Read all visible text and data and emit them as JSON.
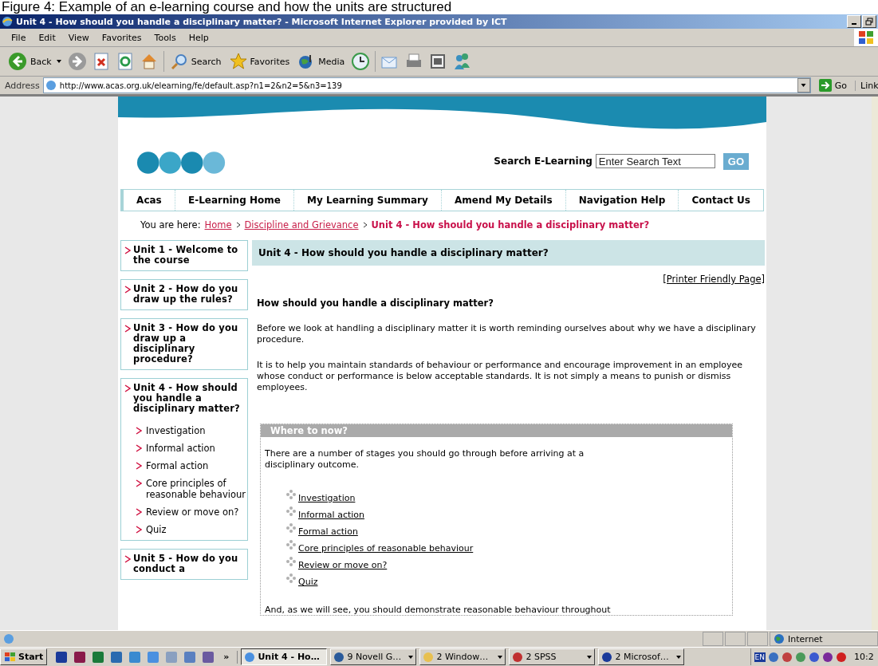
{
  "caption": "Figure 4: Example of an e-learning course and how the units are structured",
  "window": {
    "title": "Unit 4 - How should you handle a disciplinary matter? - Microsoft Internet Explorer provided by ICT"
  },
  "menu": [
    "File",
    "Edit",
    "View",
    "Favorites",
    "Tools",
    "Help"
  ],
  "toolbar": [
    {
      "kind": "back",
      "label": "Back"
    },
    {
      "kind": "forward"
    },
    {
      "kind": "stop"
    },
    {
      "kind": "refresh"
    },
    {
      "kind": "home"
    },
    {
      "kind": "search",
      "label": "Search"
    },
    {
      "kind": "favorites",
      "label": "Favorites"
    },
    {
      "kind": "media",
      "label": "Media"
    },
    {
      "kind": "history"
    },
    {
      "kind": "mail"
    },
    {
      "kind": "print"
    },
    {
      "kind": "edit"
    },
    {
      "kind": "messenger"
    }
  ],
  "address": {
    "label": "Address",
    "url": "http://www.acas.org.uk/elearning/fe/default.asp?n1=2&n2=5&n3=139",
    "go": "Go",
    "links": "Link"
  },
  "site": {
    "search_label": "Search E-Learning",
    "search_placeholder": "Enter Search Text",
    "go": "GO",
    "nav": [
      "Acas",
      "E-Learning Home",
      "My Learning Summary",
      "Amend My Details",
      "Navigation Help",
      "Contact Us"
    ],
    "breadcrumb": {
      "prefix": "You are here:",
      "links": [
        "Home",
        "Discipline and Grievance"
      ],
      "current": "Unit 4 - How should you handle a disciplinary matter?"
    }
  },
  "sidebar": [
    {
      "title": "Unit 1 - Welcome to the course"
    },
    {
      "title": "Unit 2 - How do you draw up the rules?"
    },
    {
      "title": "Unit 3 - How do you draw up a disciplinary procedure?"
    },
    {
      "title": "Unit 4 - How should you handle a disciplinary matter?",
      "children": [
        "Investigation",
        "Informal action",
        "Formal action",
        "Core principles of reasonable behaviour",
        "Review or move on?",
        "Quiz"
      ]
    },
    {
      "title": "Unit 5 - How do you conduct a"
    }
  ],
  "main": {
    "heading": "Unit 4 - How should you handle a disciplinary matter?",
    "printer": "[Printer Friendly Page]",
    "subheading": "How should you handle a disciplinary matter?",
    "paragraphs": [
      "Before we look at handling a disciplinary matter it is worth reminding ourselves about why we have a disciplinary procedure.",
      "It is to help you maintain standards of behaviour or performance and encourage improvement in an employee whose conduct or performance is below acceptable standards. It is not simply a means to punish or dismiss employees."
    ],
    "where": {
      "title": "Where to now?",
      "intro": "There are a number of stages you should go through before arriving at a disciplinary outcome.",
      "links": [
        "Investigation",
        "Informal action",
        "Formal action",
        "Core principles of reasonable behaviour",
        "Review or move on?",
        "Quiz"
      ],
      "after": "And, as we will see, you should demonstrate reasonable behaviour throughout"
    }
  },
  "status": {
    "zone": "Internet"
  },
  "taskbar": {
    "start": "Start",
    "more": "»",
    "tasks": [
      {
        "label": "Unit 4 - Ho…",
        "selected": true,
        "menu": false
      },
      {
        "label": "9 Novell G…",
        "selected": false,
        "menu": true
      },
      {
        "label": "2 Window…",
        "selected": false,
        "menu": true
      },
      {
        "label": "2 SPSS",
        "selected": false,
        "menu": true
      },
      {
        "label": "2 Microsof…",
        "selected": false,
        "menu": true
      }
    ],
    "lang": "EN",
    "clock": "10:2"
  }
}
